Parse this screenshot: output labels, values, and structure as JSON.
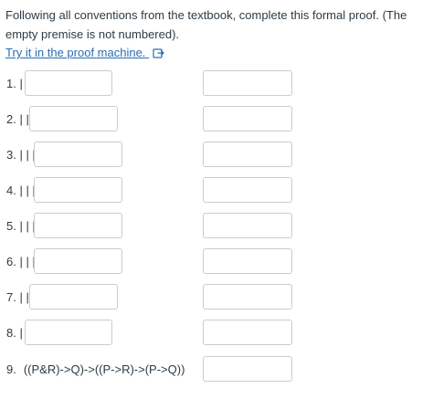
{
  "instructions": "Following all conventions from the textbook, complete this formal proof. (The empty premise is not numbered).",
  "proof_link": {
    "label": "Try it in the proof machine.",
    "icon": "external-link-icon"
  },
  "lines": [
    {
      "label": "1. |"
    },
    {
      "label": "2. | |"
    },
    {
      "label": "3. | | |"
    },
    {
      "label": "4. | | |"
    },
    {
      "label": "5. | | |"
    },
    {
      "label": "6. | | |"
    },
    {
      "label": "7. | |"
    },
    {
      "label": "8. |"
    }
  ],
  "conclusion": {
    "number": "9.",
    "formula": "((P&R)->Q)->((P->R)->(P->Q))"
  },
  "colors": {
    "text": "#2d3b45",
    "link": "#2a6db3",
    "input_border": "#c7cdd1"
  }
}
